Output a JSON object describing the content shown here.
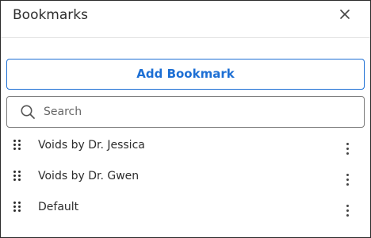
{
  "panel": {
    "title": "Bookmarks",
    "close_icon": "close-icon"
  },
  "actions": {
    "add_label": "Add Bookmark"
  },
  "search": {
    "placeholder": "Search",
    "value": "",
    "icon": "search-icon"
  },
  "bookmarks": [
    {
      "label": "Voids by Dr. Jessica"
    },
    {
      "label": "Voids by Dr. Gwen"
    },
    {
      "label": "Default"
    }
  ],
  "colors": {
    "accent": "#1d6fd4",
    "border": "#2b2b2b",
    "text": "#2d2d2d"
  }
}
